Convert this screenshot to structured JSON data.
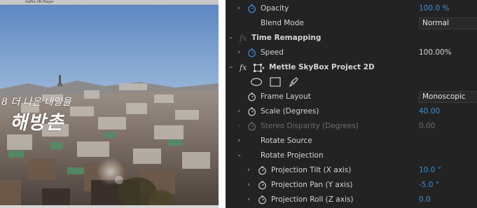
{
  "player": {
    "window_title": "GoPro VR Player",
    "overlay_subtitle": "8 더 나은 내일을",
    "overlay_title": "해방촌"
  },
  "effect_controls": {
    "colors": {
      "accent": "#3c8fda",
      "panel_bg": "#232323",
      "text": "#d4d4d4",
      "disabled": "#6c6c6c"
    },
    "rows": [
      {
        "label": "Opacity",
        "value": "100.0 %"
      },
      {
        "label": "Blend Mode",
        "value": "Normal"
      },
      {
        "label": "Time Remapping",
        "badge": "fx"
      },
      {
        "label": "Speed",
        "value": "100.00%"
      },
      {
        "label": "Mettle SkyBox Project 2D",
        "badge": "fx"
      },
      {
        "label": "Frame Layout",
        "value": "Monoscopic"
      },
      {
        "label": "Scale (Degrees)",
        "value": "40.00"
      },
      {
        "label": "Stereo Disparity (Degrees)",
        "value": "0.00"
      },
      {
        "label": "Rotate Source"
      },
      {
        "label": "Rotate Projection"
      },
      {
        "label": "Projection Tilt (X axis)",
        "value": "10.0 °"
      },
      {
        "label": "Projection Pan (Y axis)",
        "value": "-5.0 °"
      },
      {
        "label": "Projection Roll (Z axis)",
        "value": "0.0"
      }
    ],
    "mask_tools": [
      "ellipse-mask-icon",
      "rectangle-mask-icon",
      "pen-mask-icon"
    ]
  }
}
